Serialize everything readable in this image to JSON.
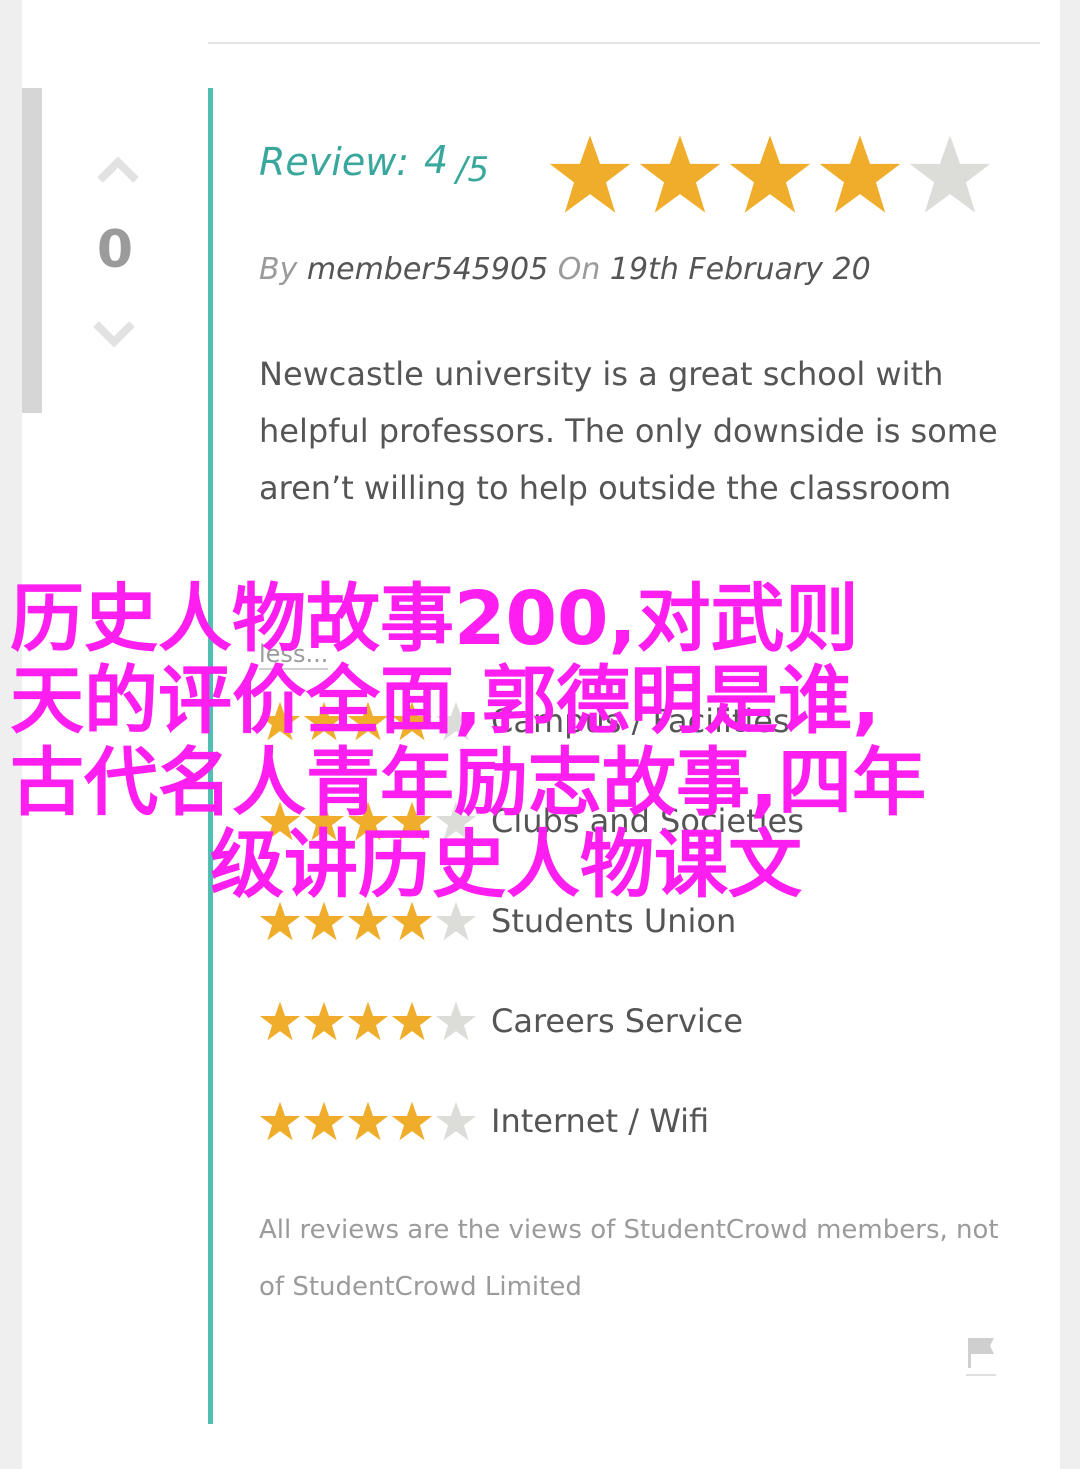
{
  "vote": {
    "count": "0"
  },
  "review": {
    "label": "Review:",
    "score": "4",
    "out_of": "/5",
    "rating": 4,
    "max": 5
  },
  "byline": {
    "by": "By",
    "member": "member545905",
    "on": "On",
    "date": "19th February 20"
  },
  "body": "Newcastle university is a great school with helpful professors. The only downside is some aren’t willing to help outside the classroom",
  "less_link": "less...",
  "ratings": [
    {
      "label": "Campus / Facilities",
      "stars": 4
    },
    {
      "label": "Clubs and Societies",
      "stars": 4
    },
    {
      "label": "Students Union",
      "stars": 4
    },
    {
      "label": "Careers Service",
      "stars": 4
    },
    {
      "label": "Internet / Wifi",
      "stars": 4
    }
  ],
  "disclaimer": "All reviews are the views of StudentCrowd members, not of StudentCrowd Limited",
  "overlay": {
    "line1": "历史人物故事200,对武则",
    "line2": "天的评价全面,郭德明是谁,",
    "line3": "古代名人青年励志故事,四年",
    "line4": "级讲历史人物课文"
  },
  "colors": {
    "accent": "#3aa79c",
    "star_on": "#f0ad2b",
    "star_off": "#dcdcd9",
    "overlay": "#ff1ef0"
  },
  "icons": {
    "upvote": "chevron-up-icon",
    "downvote": "chevron-down-icon",
    "flag": "flag-icon",
    "star": "star-icon"
  }
}
